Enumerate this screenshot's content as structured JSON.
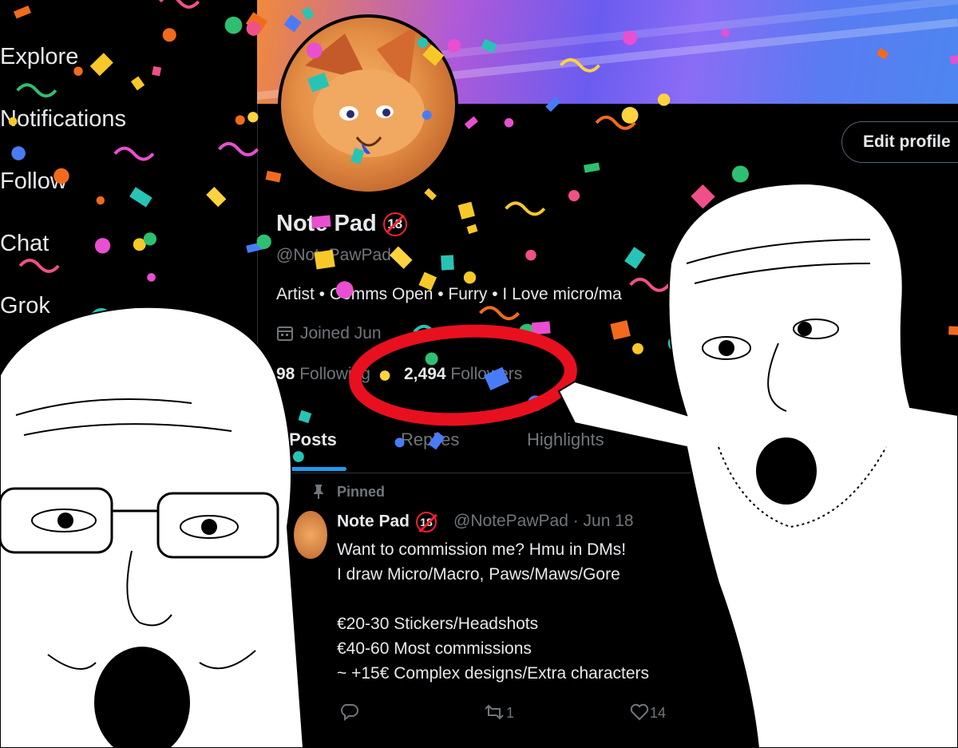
{
  "sidebar": {
    "items": [
      {
        "label": "Explore"
      },
      {
        "label": "Notifications"
      },
      {
        "label": "Follow"
      },
      {
        "label": "Chat"
      },
      {
        "label": "Grok"
      }
    ]
  },
  "profile": {
    "edit_button": "Edit profile",
    "display_name": "Note Pad",
    "age_badge": "18",
    "handle": "@NotePawPad",
    "bio": "Artist • Comms Open • Furry • I Love micro/ma",
    "joined": "Joined Jun",
    "following_count": "98",
    "following_label": "Following",
    "followers_count": "2,494",
    "followers_label": "Followers"
  },
  "tabs": [
    {
      "label": "Posts"
    },
    {
      "label": "Replies"
    },
    {
      "label": "Highlights"
    }
  ],
  "pinned_post": {
    "pinned_label": "Pinned",
    "author": "Note Pad",
    "badge": "18",
    "meta": "@NotePawPad · Jun 18",
    "lines": [
      "Want to commission me? Hmu in DMs!",
      "I draw Micro/Macro, Paws/Maws/Gore",
      "",
      "€20-30 Stickers/Headshots",
      "€40-60 Most commissions",
      "~ +15€ Complex designs/Extra characters"
    ],
    "reposts": "1",
    "likes": "14"
  },
  "colors": {
    "accent": "#1d9bf0",
    "highlight_circle": "#e8101e",
    "muted_text": "#71767b",
    "age_badge": "#f4212e"
  }
}
